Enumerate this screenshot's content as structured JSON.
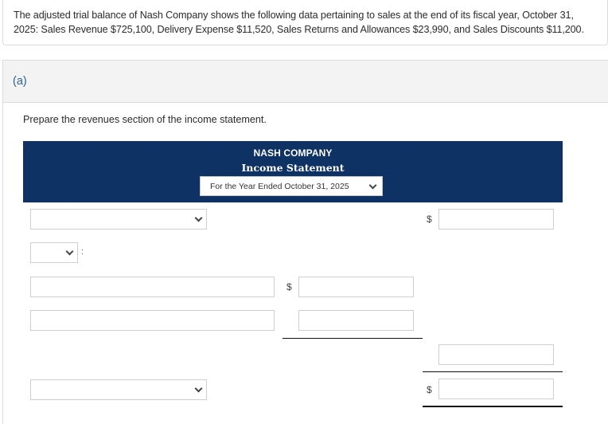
{
  "problem": {
    "text": "The adjusted trial balance of Nash Company shows the following data pertaining to sales at the end of its fiscal year, October 31, 2025: Sales Revenue $725,100, Delivery Expense $11,520, Sales Returns and Allowances $23,990, and Sales Discounts $11,200."
  },
  "part": {
    "label": "(a)",
    "instruction": "Prepare the revenues section of the income statement."
  },
  "statement": {
    "company": "NASH COMPANY",
    "title": "Income Statement",
    "period_selected": "For the Year Ended October 31, 2025"
  },
  "rows": {
    "row1": {
      "account_select": "",
      "currency": "$",
      "amount": ""
    },
    "row2": {
      "label_select": "",
      "colon": ":"
    },
    "row3": {
      "account": "",
      "currency": "$",
      "amount": ""
    },
    "row4": {
      "account": "",
      "amount": ""
    },
    "row5": {
      "amount": ""
    },
    "row6": {
      "account_select": "",
      "currency": "$",
      "amount": ""
    }
  }
}
